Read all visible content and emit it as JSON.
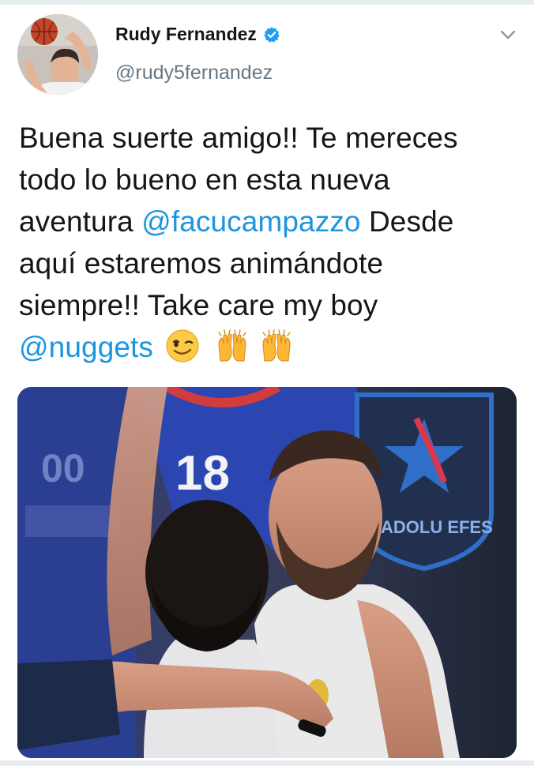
{
  "tweet": {
    "author_name": "Rudy Fernandez",
    "author_handle": "@rudy5fernandez",
    "text": {
      "line1": "Buena suerte amigo!! Te mereces",
      "line2": "todo lo bueno en esta nueva",
      "line3_pre": "aventura ",
      "mention1": "@facucampazzo",
      "line3_post": " Desde",
      "line4": "aquí estaremos animándote",
      "line5": "siempre!! Take care my boy",
      "mention2": "@nuggets"
    },
    "emojis": [
      "winking-face-emoji",
      "raising-hands-emoji",
      "raising-hands-emoji"
    ]
  },
  "photo": {
    "jersey_number": "18",
    "jersey_number_left": "00",
    "badge_text": "ANADOLU EFES"
  },
  "icons": {
    "verified": "verified-badge-icon",
    "menu": "chevron-down-icon"
  },
  "colors": {
    "mention": "#1b95e0",
    "handle": "#657786",
    "verified": "#1da1f2"
  }
}
